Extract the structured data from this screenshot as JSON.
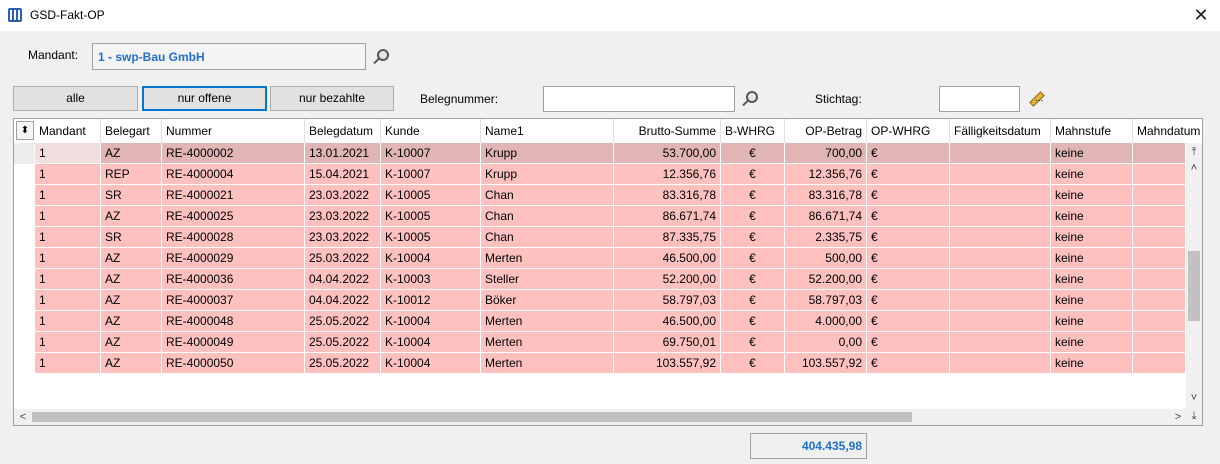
{
  "window": {
    "title": "GSD-Fakt-OP"
  },
  "mandant": {
    "label": "Mandant:",
    "value": "1 - swp-Bau GmbH"
  },
  "filters": {
    "alle": "alle",
    "offene": "nur offene",
    "bezahlte": "nur bezahlte"
  },
  "belegnummer": {
    "label": "Belegnummer:",
    "value": ""
  },
  "stichtag": {
    "label": "Stichtag:",
    "value": ""
  },
  "columns": [
    "Mandant",
    "Belegart",
    "Nummer",
    "Belegdatum",
    "Kunde",
    "Name1",
    "Brutto-Summe",
    "B-WHRG",
    "OP-Betrag",
    "OP-WHRG",
    "Fälligkeitsdatum",
    "Mahnstufe",
    "Mahndatum"
  ],
  "rows": [
    {
      "mandant": "1",
      "belegart": "AZ",
      "nummer": "RE-4000002",
      "belegdatum": "13.01.2021",
      "kunde": "K-10007",
      "name1": "Krupp",
      "brutto": "53.700,00",
      "bwhrg": "€",
      "op": "700,00",
      "opwhrg": "€",
      "faellig": "",
      "mahnstufe": "keine"
    },
    {
      "mandant": "1",
      "belegart": "REP",
      "nummer": "RE-4000004",
      "belegdatum": "15.04.2021",
      "kunde": "K-10007",
      "name1": "Krupp",
      "brutto": "12.356,76",
      "bwhrg": "€",
      "op": "12.356,76",
      "opwhrg": "€",
      "faellig": "",
      "mahnstufe": "keine"
    },
    {
      "mandant": "1",
      "belegart": "SR",
      "nummer": "RE-4000021",
      "belegdatum": "23.03.2022",
      "kunde": "K-10005",
      "name1": "Chan",
      "brutto": "83.316,78",
      "bwhrg": "€",
      "op": "83.316,78",
      "opwhrg": "€",
      "faellig": "",
      "mahnstufe": "keine"
    },
    {
      "mandant": "1",
      "belegart": "AZ",
      "nummer": "RE-4000025",
      "belegdatum": "23.03.2022",
      "kunde": "K-10005",
      "name1": "Chan",
      "brutto": "86.671,74",
      "bwhrg": "€",
      "op": "86.671,74",
      "opwhrg": "€",
      "faellig": "",
      "mahnstufe": "keine"
    },
    {
      "mandant": "1",
      "belegart": "SR",
      "nummer": "RE-4000028",
      "belegdatum": "23.03.2022",
      "kunde": "K-10005",
      "name1": "Chan",
      "brutto": "87.335,75",
      "bwhrg": "€",
      "op": "2.335,75",
      "opwhrg": "€",
      "faellig": "",
      "mahnstufe": "keine"
    },
    {
      "mandant": "1",
      "belegart": "AZ",
      "nummer": "RE-4000029",
      "belegdatum": "25.03.2022",
      "kunde": "K-10004",
      "name1": "Merten",
      "brutto": "46.500,00",
      "bwhrg": "€",
      "op": "500,00",
      "opwhrg": "€",
      "faellig": "",
      "mahnstufe": "keine"
    },
    {
      "mandant": "1",
      "belegart": "AZ",
      "nummer": "RE-4000036",
      "belegdatum": "04.04.2022",
      "kunde": "K-10003",
      "name1": "Steller",
      "brutto": "52.200,00",
      "bwhrg": "€",
      "op": "52.200,00",
      "opwhrg": "€",
      "faellig": "",
      "mahnstufe": "keine"
    },
    {
      "mandant": "1",
      "belegart": "AZ",
      "nummer": "RE-4000037",
      "belegdatum": "04.04.2022",
      "kunde": "K-10012",
      "name1": "Böker",
      "brutto": "58.797,03",
      "bwhrg": "€",
      "op": "58.797,03",
      "opwhrg": "€",
      "faellig": "",
      "mahnstufe": "keine"
    },
    {
      "mandant": "1",
      "belegart": "AZ",
      "nummer": "RE-4000048",
      "belegdatum": "25.05.2022",
      "kunde": "K-10004",
      "name1": "Merten",
      "brutto": "46.500,00",
      "bwhrg": "€",
      "op": "4.000,00",
      "opwhrg": "€",
      "faellig": "",
      "mahnstufe": "keine"
    },
    {
      "mandant": "1",
      "belegart": "AZ",
      "nummer": "RE-4000049",
      "belegdatum": "25.05.2022",
      "kunde": "K-10004",
      "name1": "Merten",
      "brutto": "69.750,01",
      "bwhrg": "€",
      "op": "0,00",
      "opwhrg": "€",
      "faellig": "",
      "mahnstufe": "keine"
    },
    {
      "mandant": "1",
      "belegart": "AZ",
      "nummer": "RE-4000050",
      "belegdatum": "25.05.2022",
      "kunde": "K-10004",
      "name1": "Merten",
      "brutto": "103.557,92",
      "bwhrg": "€",
      "op": "103.557,92",
      "opwhrg": "€",
      "faellig": "",
      "mahnstufe": "keine"
    }
  ],
  "total": "404.435,98",
  "colors": {
    "row_bg": "#ffc0c0",
    "selected_row_bg": "#e2b5b5",
    "accent": "#1f6fd1"
  },
  "icons": {
    "app": "grid-app-icon",
    "close": "close-icon",
    "lookup": "magnifier-icon",
    "edit": "pencil-icon"
  }
}
